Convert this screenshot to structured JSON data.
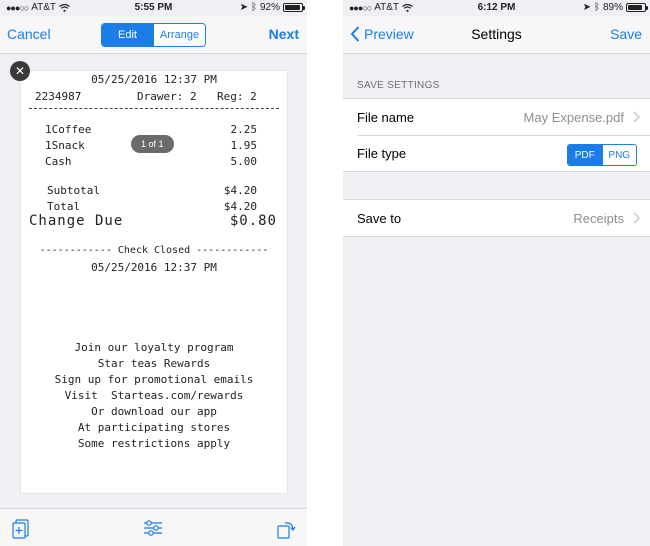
{
  "left_screen": {
    "status": {
      "carrier": "AT&T",
      "time": "5:55 PM",
      "battery_text": "92%",
      "battery_level": 0.92
    },
    "nav": {
      "cancel_label": "Cancel",
      "next_label": "Next",
      "seg_edit": "Edit",
      "seg_arrange": "Arrange"
    },
    "close_label": "✕",
    "page_indicator": "1 of 1",
    "receipt": {
      "header_datetime": "05/25/2016 12:37 PM",
      "header_id": "2234987",
      "header_drawer": "Drawer: 2",
      "header_reg": "Reg: 2",
      "items": [
        {
          "name": "1Coffee",
          "price": "2.25"
        },
        {
          "name": "1Snack",
          "price": "1.95"
        },
        {
          "name": "Cash",
          "price": "5.00"
        }
      ],
      "subtotal_label": "Subtotal",
      "subtotal_value": "$4.20",
      "total_label": "Total",
      "total_value": "$4.20",
      "change_label": "Change Due",
      "change_value": "$0.80",
      "closed_label": "------------ Check Closed ------------",
      "closed_datetime": "05/25/2016 12:37 PM",
      "footer": [
        "Join our loyalty program",
        "Star teas Rewards",
        "Sign up for promotional emails",
        "Visit  Starteas.com/rewards",
        "Or download our app",
        "At participating stores",
        "Some restrictions apply"
      ]
    },
    "toolbar_icons": [
      "add-page-icon",
      "adjust-sliders-icon",
      "rotate-icon"
    ]
  },
  "right_screen": {
    "status": {
      "carrier": "AT&T",
      "time": "6:12 PM",
      "battery_text": "89%",
      "battery_level": 0.89
    },
    "nav": {
      "back_label": "Preview",
      "title": "Settings",
      "save_label": "Save"
    },
    "section_header": "SAVE SETTINGS",
    "file_name": {
      "label": "File name",
      "value": "May Expense.pdf"
    },
    "file_type": {
      "label": "File type",
      "options": [
        "PDF",
        "PNG"
      ],
      "selected": "PDF"
    },
    "save_to": {
      "label": "Save to",
      "value": "Receipts"
    }
  },
  "colors": {
    "accent": "#1a7de8",
    "background": "#efeff4",
    "secondary_text": "#8e8e93"
  }
}
